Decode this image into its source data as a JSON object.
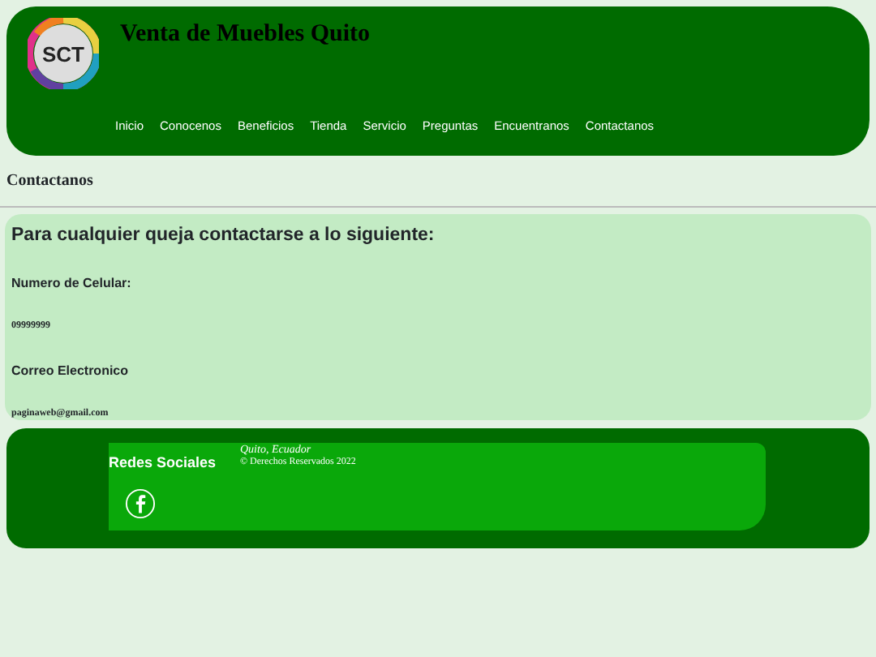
{
  "header": {
    "logo_text": "SCT",
    "title": "Venta de Muebles Quito",
    "nav": [
      "Inicio",
      "Conocenos",
      "Beneficios",
      "Tienda",
      "Servicio",
      "Preguntas",
      "Encuentranos",
      "Contactanos"
    ]
  },
  "page_heading": "Contactanos",
  "contact": {
    "heading": "Para cualquier queja contactarse a lo siguiente:",
    "items": [
      {
        "label": "Numero de Celular:",
        "value": "09999999"
      },
      {
        "label": "Correo Electronico",
        "value": "paginaweb@gmail.com"
      }
    ]
  },
  "footer": {
    "social_heading": "Redes Sociales",
    "location": "Quito, Ecuador",
    "copyright": "© Derechos Reservados 2022"
  }
}
